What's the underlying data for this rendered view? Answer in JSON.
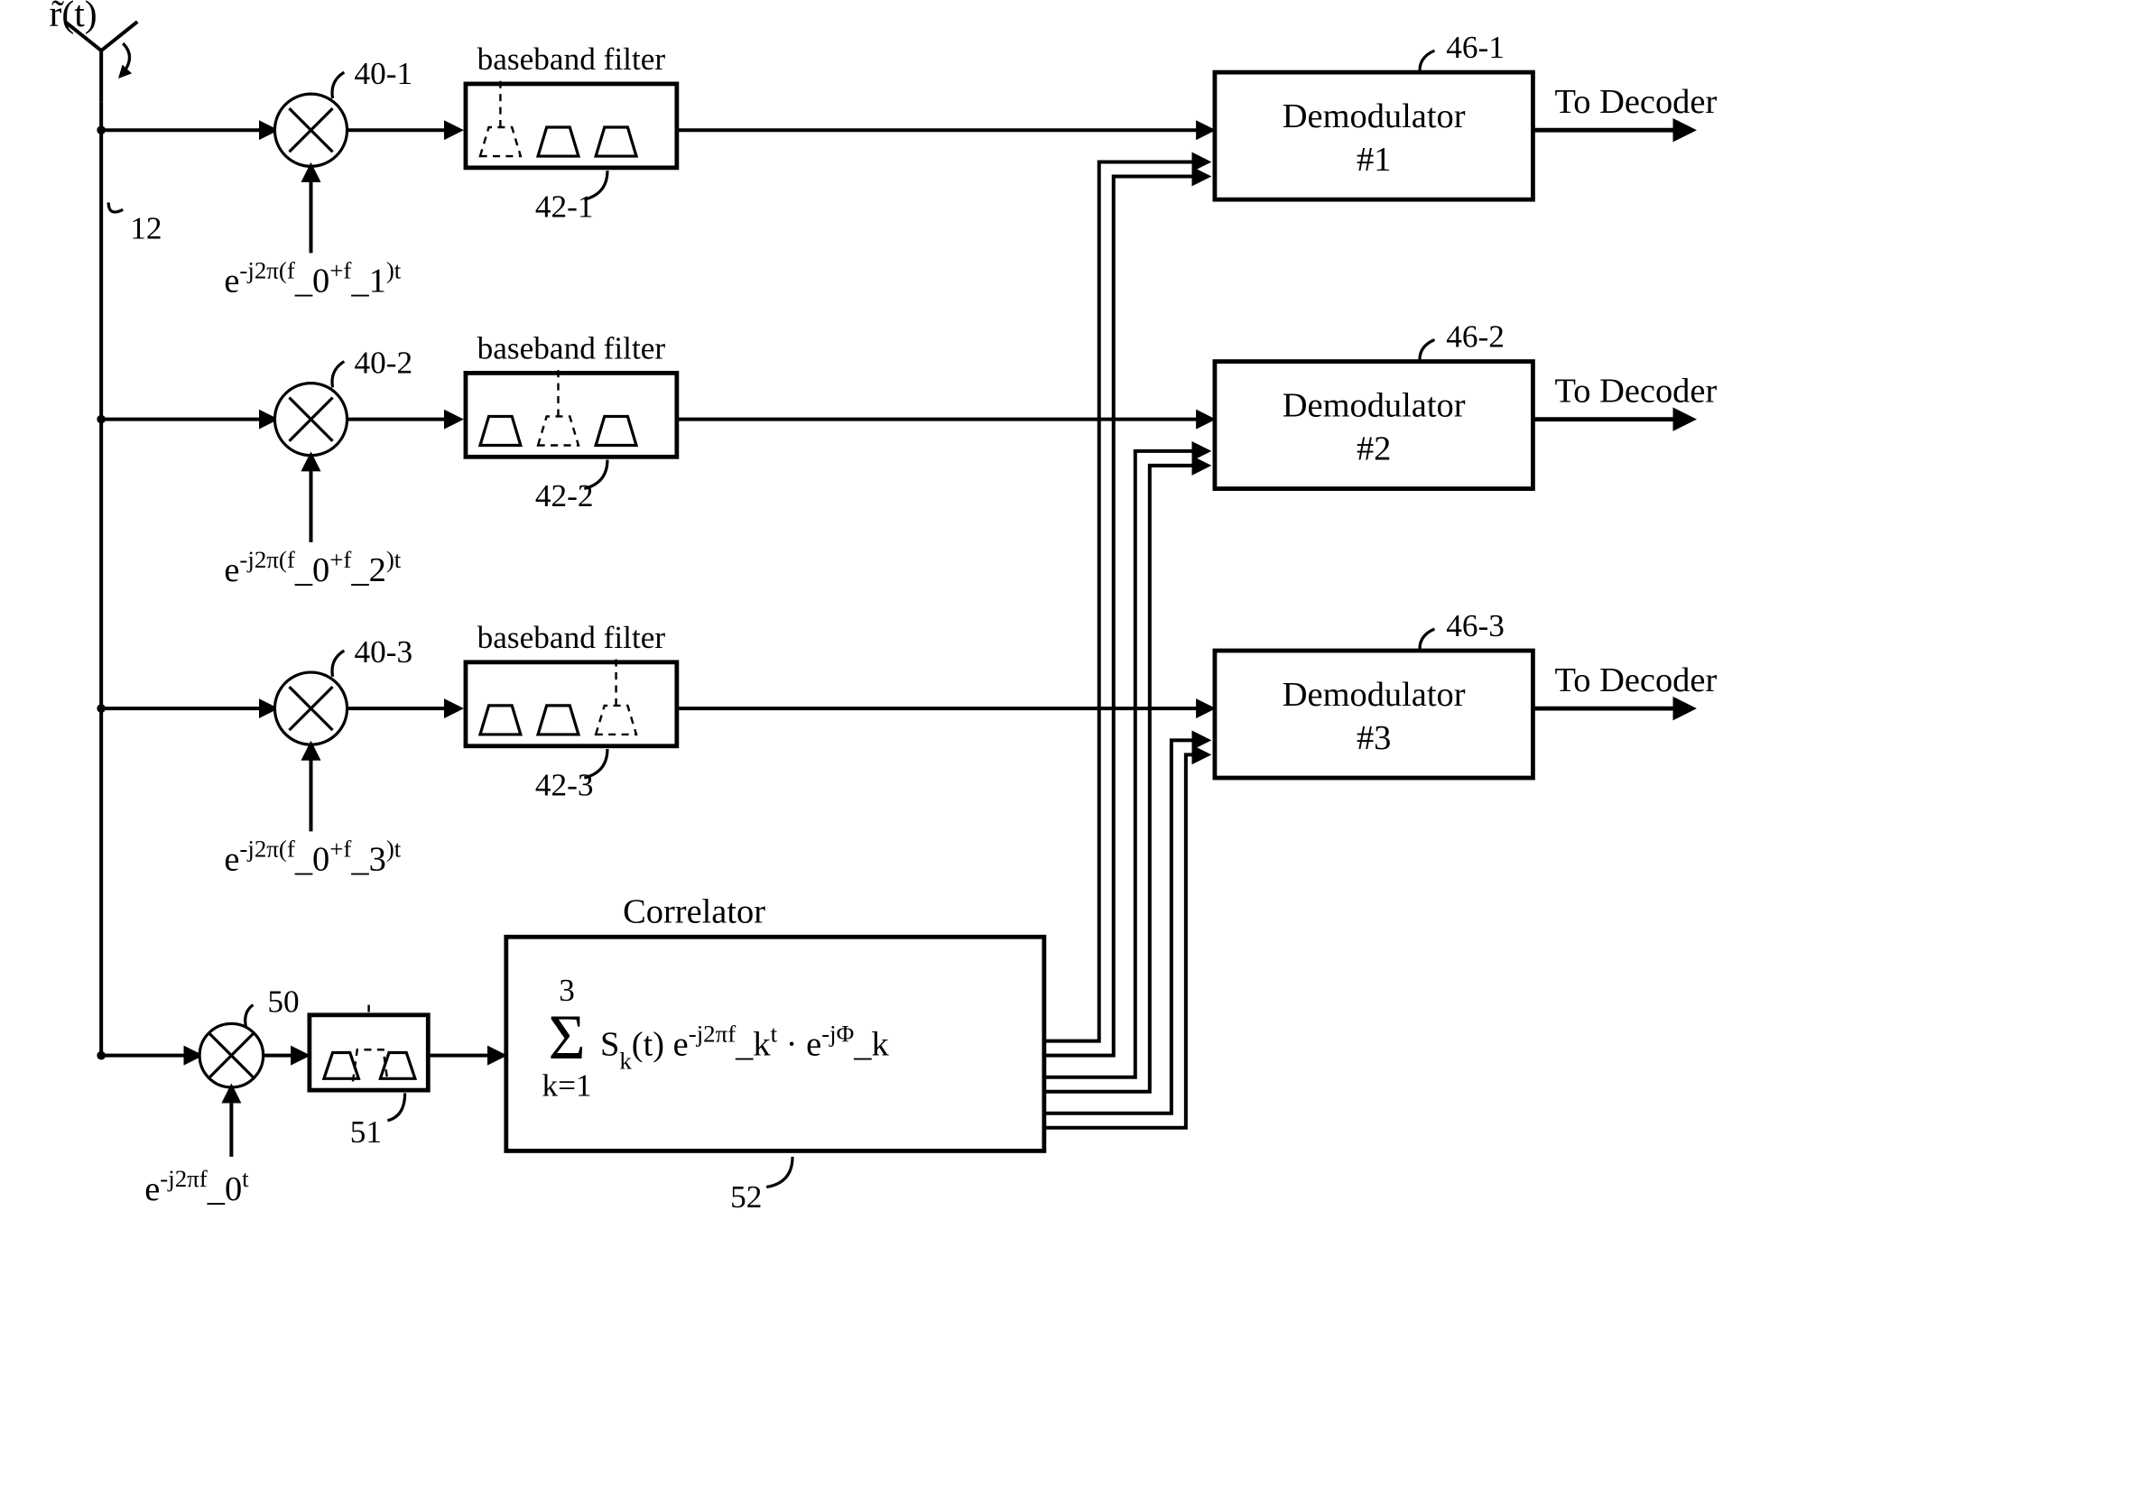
{
  "input": {
    "label": "r̃(t)",
    "ref": "12"
  },
  "branches": [
    {
      "mixer_ref": "40-1",
      "mixer_input": "e$-j2π(f$_0$+f$_1$)t$",
      "filter_label": "baseband filter",
      "filter_ref": "42-1",
      "filter_select": 1,
      "demod_ref": "46-1",
      "demod_line1": "Demodulator",
      "demod_line2": "#1",
      "out_label": "To Decoder"
    },
    {
      "mixer_ref": "40-2",
      "mixer_input": "e$-j2π(f$_0$+f$_2$)t$",
      "filter_label": "baseband filter",
      "filter_ref": "42-2",
      "filter_select": 2,
      "demod_ref": "46-2",
      "demod_line1": "Demodulator",
      "demod_line2": "#2",
      "out_label": "To Decoder"
    },
    {
      "mixer_ref": "40-3",
      "mixer_input": "e$-j2π(f$_0$+f$_3$)t$",
      "filter_label": "baseband filter",
      "filter_ref": "42-3",
      "filter_select": 3,
      "demod_ref": "46-3",
      "demod_line1": "Demodulator",
      "demod_line2": "#3",
      "out_label": "To Decoder"
    }
  ],
  "correlator_branch": {
    "mixer_ref": "50",
    "mixer_input": "e$-j2πf$_0$t$",
    "filter_ref": "51"
  },
  "correlator": {
    "label": "Correlator",
    "ref": "52",
    "sum_upper": "3",
    "sum_lower": "k=1",
    "formula_pre": "S$_k$(t) ",
    "formula_exp1": "e$-j2πf$_k$t$",
    "formula_dot": " · ",
    "formula_exp2": "e$-jΦ$_k$$"
  }
}
